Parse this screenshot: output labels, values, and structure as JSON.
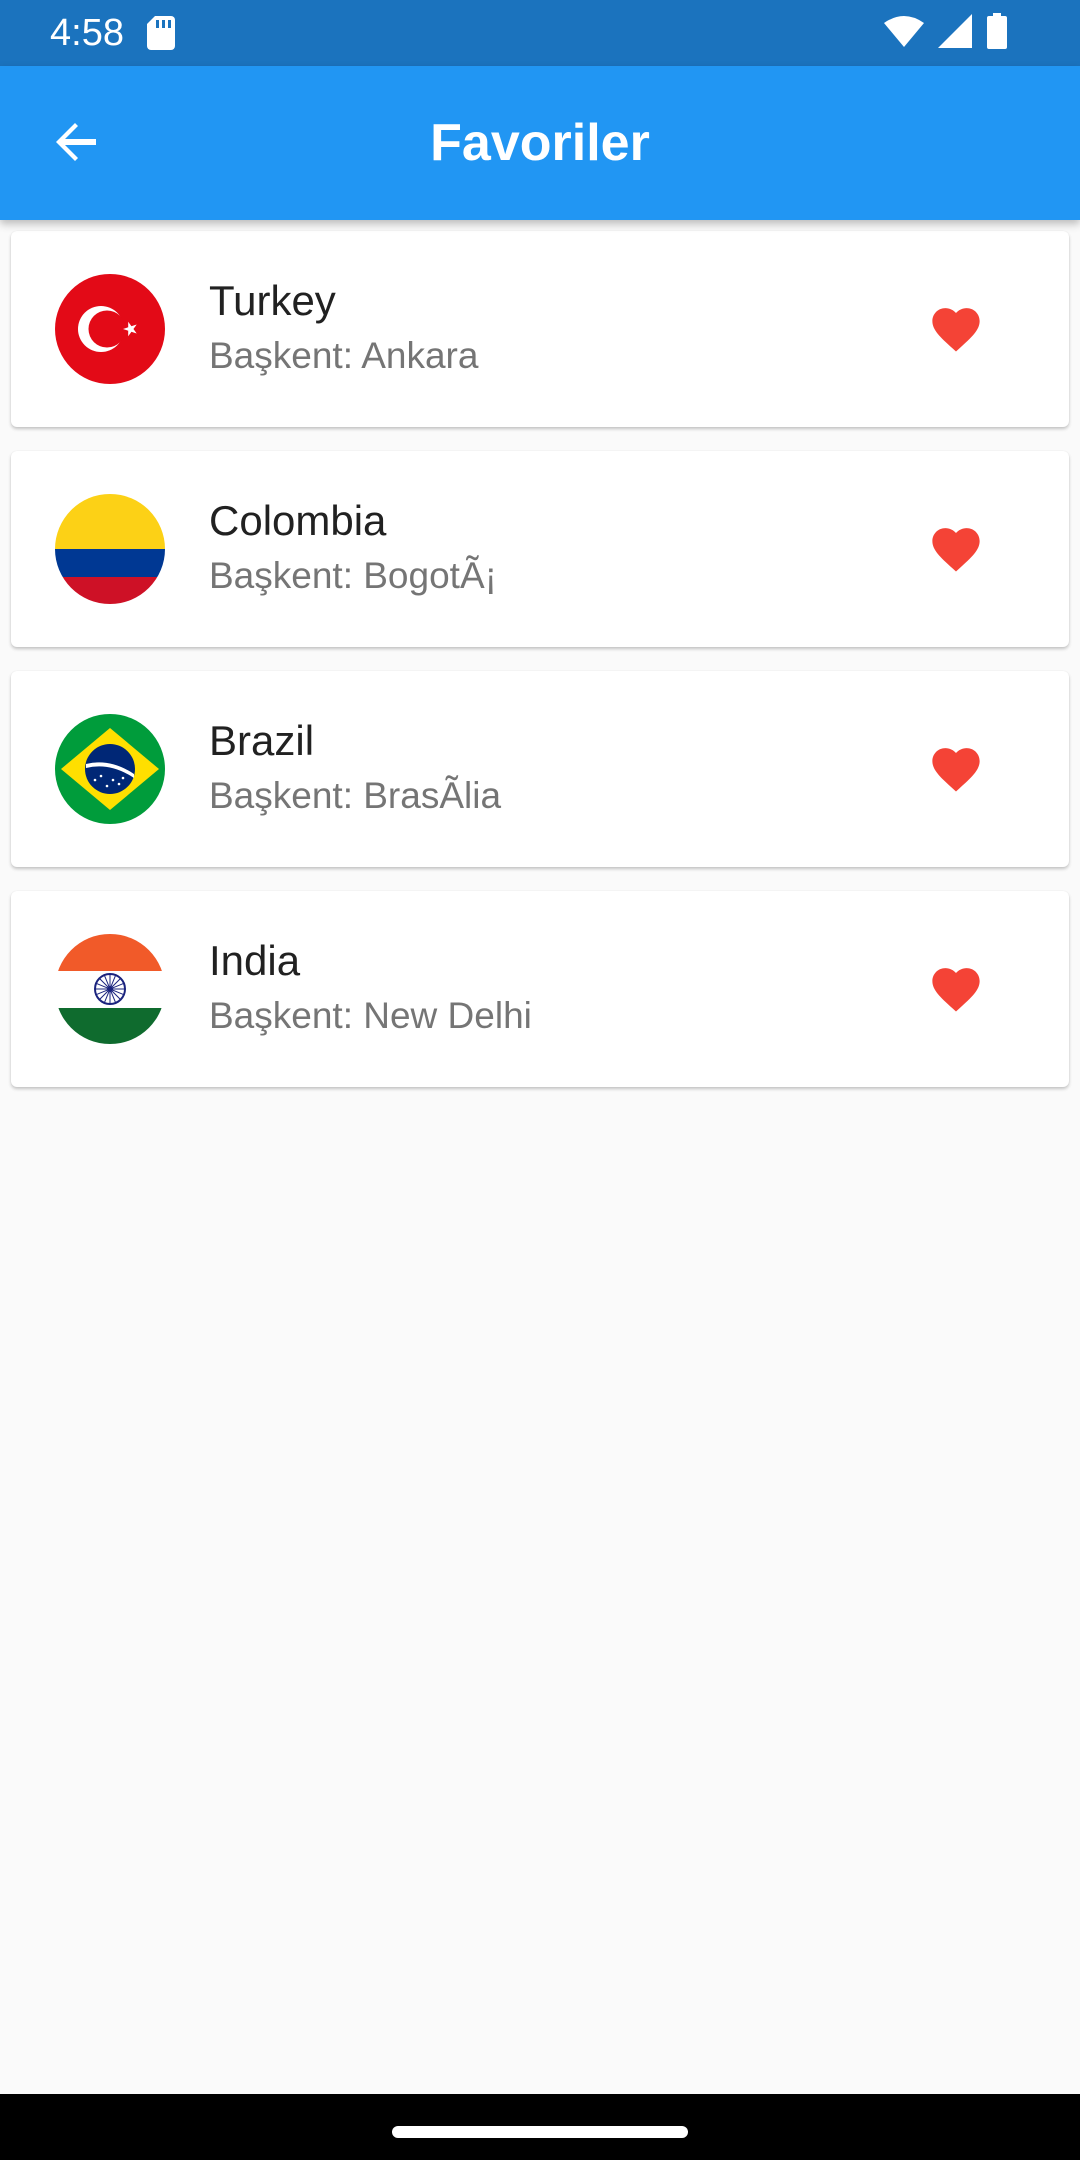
{
  "status_bar": {
    "time": "4:58",
    "icons": [
      "sd-card-icon",
      "wifi-icon",
      "signal-icon",
      "battery-icon"
    ],
    "background": "#1b73be"
  },
  "app_bar": {
    "title": "Favoriler",
    "back_icon": "arrow-back-icon",
    "background": "#2196f3"
  },
  "favorites": [
    {
      "name": "Turkey",
      "capital": "Başkent: Ankara",
      "flag_icon": "turkey-flag-icon",
      "favorite_icon": "heart-filled-icon"
    },
    {
      "name": "Colombia",
      "capital": "Başkent: BogotÃ¡",
      "flag_icon": "colombia-flag-icon",
      "favorite_icon": "heart-filled-icon"
    },
    {
      "name": "Brazil",
      "capital": "Başkent: BrasÃlia",
      "flag_icon": "brazil-flag-icon",
      "favorite_icon": "heart-filled-icon"
    },
    {
      "name": "India",
      "capital": "Başkent: New Delhi",
      "flag_icon": "india-flag-icon",
      "favorite_icon": "heart-filled-icon"
    }
  ],
  "colors": {
    "heart": "#f44336",
    "title_text": "#212121",
    "subtitle_text": "#757575",
    "page_background": "#fafafa"
  }
}
